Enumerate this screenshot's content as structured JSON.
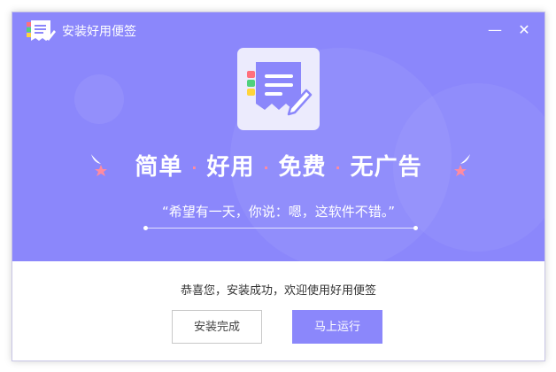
{
  "window": {
    "title": "安装好用便签",
    "minimize_glyph": "—",
    "close_glyph": "✕"
  },
  "hero": {
    "slogan": [
      "简单",
      "好用",
      "免费",
      "无广告"
    ],
    "separator": "·",
    "quote": "“希望有一天，你说：嗯，这软件不错。”"
  },
  "footer": {
    "message": "恭喜您，安装成功，欢迎使用好用便签",
    "done_label": "安装完成",
    "run_label": "马上运行"
  },
  "colors": {
    "accent": "#8b87fb",
    "sparkle": "#ff8ba0"
  },
  "icons": [
    "app-logo-icon",
    "minimize-icon",
    "close-icon",
    "note-logo-icon",
    "sparkle-icon"
  ]
}
